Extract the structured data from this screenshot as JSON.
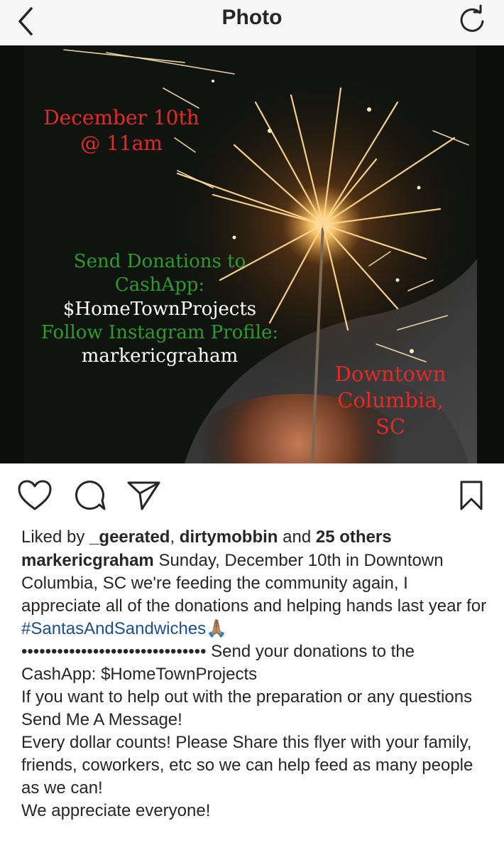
{
  "header": {
    "title": "Photo",
    "back_icon": "chevron-left-icon",
    "refresh_icon": "refresh-icon"
  },
  "flyer": {
    "date_line1": "December 10th",
    "date_line2": "@ 11am",
    "donate_line1": "Send Donations to",
    "donate_line2": "CashApp:",
    "cashtag": "$HomeTownProjects",
    "follow_line": "Follow Instagram Profile:",
    "profile": "markericgraham",
    "location_line1": "Downtown",
    "location_line2": "Columbia,",
    "location_line3": "SC",
    "colors": {
      "red": "#e52a26",
      "green": "#2f9a2c"
    }
  },
  "actions": {
    "like_icon": "heart-icon",
    "comment_icon": "comment-icon",
    "share_icon": "send-icon",
    "save_icon": "bookmark-icon"
  },
  "likes": {
    "prefix": "Liked by ",
    "user1": "_geerated",
    "sep": ", ",
    "user2": "dirtymobbin",
    "and": " and ",
    "others": "25 others"
  },
  "caption": {
    "username": "markericgraham",
    "text1": " Sunday, December 10th in Downtown Columbia, SC we're feeding the community again, I appreciate all of the donations and helping hands last year for",
    "hashtag": "#SantasAndSandwiches",
    "emoji": "🙏🏽",
    "dots": "•••••••••••••••••••••••••••••••",
    "text2": " Send your donations to the CashApp: $HomeTownProjects",
    "text3": "If you want to help out with the preparation or any questions Send Me A Message!",
    "text4": "Every dollar counts! Please Share this flyer with your family, friends, coworkers, etc so we can help feed as many people as we can!",
    "text5": "We appreciate everyone!"
  }
}
